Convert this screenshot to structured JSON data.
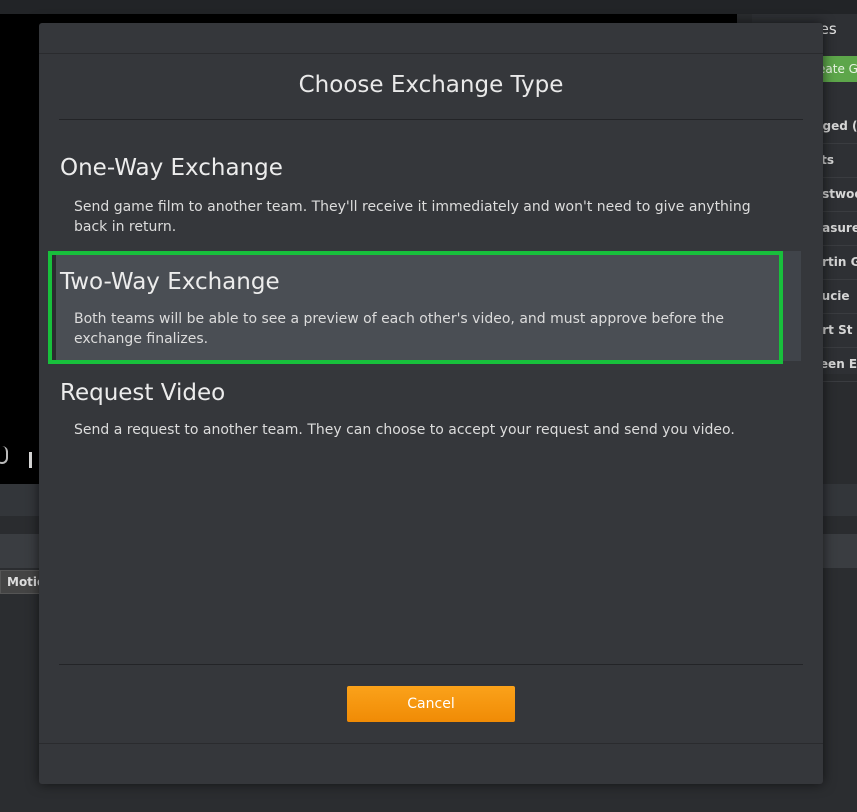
{
  "background": {
    "sidebar_title": "mes",
    "create_button": "eate Ga",
    "games": [
      "nged (",
      "sts",
      "estwoo",
      "easure",
      "artin G",
      "Lucie",
      "ort St",
      "reen E"
    ],
    "motion_tab": "Motio"
  },
  "modal": {
    "title": "Choose Exchange Type",
    "options": [
      {
        "title": "One-Way Exchange",
        "description": "Send game film to another team. They'll receive it immediately and won't need to give anything back in return."
      },
      {
        "title": "Two-Way Exchange",
        "description": "Both teams will be able to see a preview of each other's video, and must approve before the exchange finalizes."
      },
      {
        "title": "Request Video",
        "description": "Send a request to another team. They can choose to accept your request and send you video."
      }
    ],
    "cancel_label": "Cancel"
  },
  "colors": {
    "accent": "#f7971a",
    "highlight_border": "#18c03c",
    "modal_bg": "#35373b"
  }
}
